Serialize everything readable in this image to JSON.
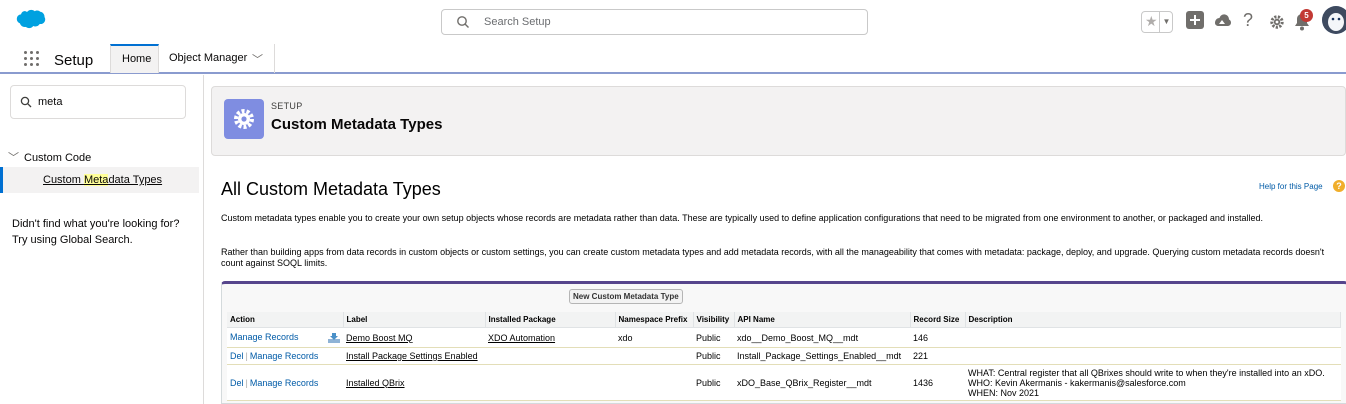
{
  "header": {
    "search_placeholder": "Search Setup",
    "notification_count": "5",
    "icons": [
      "salesforce-cloud-icon",
      "favorites-star-icon",
      "add-icon",
      "trailhead-icon",
      "help-icon",
      "gear-icon",
      "bell-icon",
      "avatar"
    ]
  },
  "nav": {
    "app_name": "Setup",
    "tabs": [
      {
        "label": "Home"
      },
      {
        "label": "Object Manager"
      }
    ]
  },
  "sidebar": {
    "quick_find_value": "meta",
    "tree_heading": "Custom Code",
    "item_pre": "Custom ",
    "item_hl": "Meta",
    "item_post": "data Types",
    "hint_line1": "Didn't find what you're looking for?",
    "hint_line2": "Try using Global Search."
  },
  "page": {
    "breadcrumb": "SETUP",
    "title": "Custom Metadata Types",
    "section_title": "All Custom Metadata Types",
    "help_link": "Help for this Page",
    "para1": "Custom metadata types enable you to create your own setup objects whose records are metadata rather than data. These are typically used to define application configurations that need to be migrated from one environment to another, or packaged and installed.",
    "para2": "Rather than building apps from data records in custom objects or custom settings, you can create custom metadata types and add metadata records, with all the manageability that comes with metadata: package, deploy, and upgrade. Querying custom metadata records doesn't count against SOQL limits.",
    "new_button": "New Custom Metadata Type"
  },
  "table": {
    "columns": [
      "Action",
      "Label",
      "Installed Package",
      "Namespace Prefix",
      "Visibility",
      "API Name",
      "Record Size",
      "Description"
    ],
    "rows": [
      {
        "action_del": "",
        "action_manage": "Manage Records",
        "label": "Demo Boost MQ",
        "package": "XDO Automation",
        "namespace": "xdo",
        "visibility": "Public",
        "api": "xdo__Demo_Boost_MQ__mdt",
        "size": "146",
        "desc1": "",
        "desc2": "",
        "desc3": ""
      },
      {
        "action_del": "Del",
        "action_manage": "Manage Records",
        "label": "Install Package Settings Enabled",
        "package": "",
        "namespace": "",
        "visibility": "Public",
        "api": "Install_Package_Settings_Enabled__mdt",
        "size": "221",
        "desc1": "",
        "desc2": "",
        "desc3": ""
      },
      {
        "action_del": "Del",
        "action_manage": "Manage Records",
        "label": "Installed QBrix",
        "package": "",
        "namespace": "",
        "visibility": "Public",
        "api": "xDO_Base_QBrix_Register__mdt",
        "size": "1436",
        "desc1": "WHAT: Central register that all QBrixes should write to when they're installed into an xDO.",
        "desc2": "WHO: Kevin Akermanis - kakermanis@salesforce.com",
        "desc3": "WHEN: Nov 2021"
      }
    ]
  }
}
